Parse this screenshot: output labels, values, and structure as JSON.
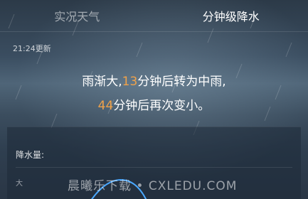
{
  "tabs": [
    {
      "label": "实况天气",
      "active": false
    },
    {
      "label": "分钟级降水",
      "active": true
    }
  ],
  "updated_text": "21:24更新",
  "forecast": {
    "line1_prefix": "雨渐大,",
    "line1_minutes": "13",
    "line1_suffix": "分钟后转为中雨,",
    "line2_minutes": "44",
    "line2_suffix": "分钟后再次变小。"
  },
  "precip_panel": {
    "title": "降水量:",
    "level_label": "大"
  },
  "watermark": "晨曦乐下载 • CXLEDU.COM",
  "colors": {
    "accent_number": "#f0a24a",
    "curve": "#4aa8ff"
  }
}
